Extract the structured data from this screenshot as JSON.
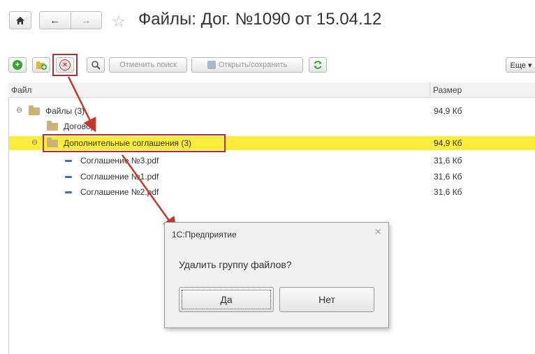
{
  "nav": {
    "home_icon": "home-icon",
    "back_icon": "←",
    "forward_icon": "→",
    "star_icon": "☆",
    "title": "Файлы: Дог. №1090 от 15.04.12"
  },
  "toolbar": {
    "cancel_search_label": "Отменить поиск",
    "open_save_label": "Открыть/сохранить",
    "more_label": "Еще ▾",
    "icons": [
      "add-icon",
      "add-file-icon",
      "delete-icon",
      "search-icon",
      "refresh-icon"
    ]
  },
  "table": {
    "columns": [
      "Файл",
      "Размер"
    ],
    "rows": [
      {
        "name": "Файлы (3)",
        "size": "94,9 Кб",
        "type": "folder",
        "expanded": "⊖"
      },
      {
        "name": "Договор",
        "size": "",
        "type": "folder",
        "expanded": ""
      },
      {
        "name": "Дополнительные соглашения (3)",
        "size": "94,9 Кб",
        "type": "folder",
        "expanded": "⊖",
        "selected": true
      },
      {
        "name": "Соглашение №3.pdf",
        "size": "31,6 Кб",
        "type": "file"
      },
      {
        "name": "Соглашение №1.pdf",
        "size": "31,6 Кб",
        "type": "file"
      },
      {
        "name": "Соглашение №2.pdf",
        "size": "31,6 Кб",
        "type": "file"
      }
    ]
  },
  "dialog": {
    "title": "1С:Предприятие",
    "close": "×",
    "message": "Удалить группу файлов?",
    "yes_label": "Да",
    "no_label": "Нет"
  },
  "colors": {
    "selection": "#fcec3b",
    "highlight_border": "#a8323c",
    "arrow": "#c0392b"
  }
}
